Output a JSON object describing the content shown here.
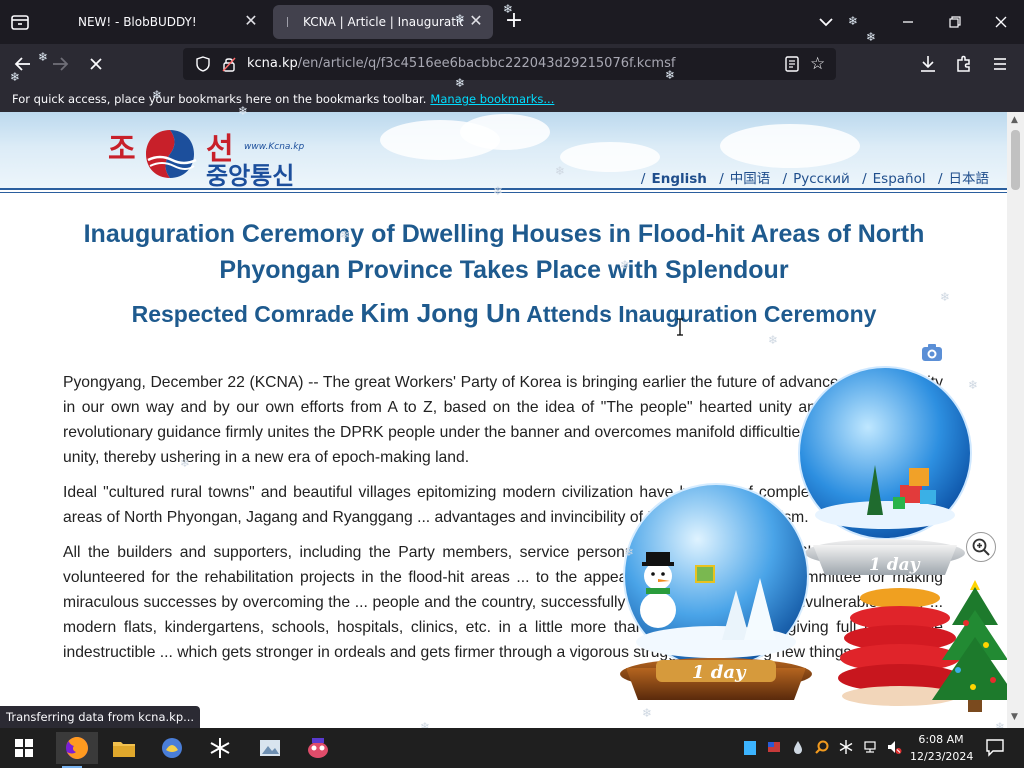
{
  "browser": {
    "tabs": [
      {
        "title": "NEW! - BlobBUDDY!",
        "active": false
      },
      {
        "title": "KCNA | Article | Inauguration",
        "active": true
      }
    ],
    "url_host": "kcna.kp",
    "url_path": "/en/article/q/f3c4516ee6bacbbc222043d29215076f.kcmsf",
    "bookmarks_message": "For quick access, place your bookmarks here on the bookmarks toolbar.",
    "bookmarks_link": "Manage bookmarks...",
    "status_text": "Transferring data from kcna.kp..."
  },
  "site": {
    "logo_line1_a": "조",
    "logo_line1_b": "선",
    "logo_line2": "중앙통신",
    "logo_www": "www.Kcna.kp",
    "languages": [
      "English",
      "中国语",
      "Русский",
      "Español",
      "日本語"
    ],
    "active_language": "English"
  },
  "article": {
    "title": "Inauguration Ceremony of Dwelling Houses in Flood-hit Areas of North Phyongan Province Takes Place with Splendour",
    "subtitle_pre": "Respected Comrade ",
    "subtitle_name": "Kim Jong Un",
    "subtitle_post": " Attends Inauguration Ceremony",
    "paragraphs": [
      "Pyongyang, December 22 (KCNA) -- The great Workers' Party of Korea is bringing earlier the future of advance and prosperity in our own way and by our own efforts from A to Z, based on the idea of \"The people\" hearted unity and self-reliance. Its revolutionary guidance firmly unites the DPRK people under the banner and overcomes manifold difficulties by dint of the great unity, thereby ushering in a new era of epoch-making land.",
      "Ideal \"cultured rural towns\" and beautiful villages epitomizing modern civilization have been ... of completion in the flood-hit areas of North Phyongan, Jagang and Ryanggang ... advantages and invincibility of Korean-style socialism.",
      "All the builders and supporters, including the Party members, service personnel ... Paektusan Hero Shock Brigade, who volunteered for the rehabilitation projects in the flood-hit areas ... to the appeal of the Party Central Committee for making miraculous successes by overcoming the ... people and the country, successfully built the embankments invulnerable to any ... modern flats, kindergartens, schools, hospitals, clinics, etc. in a little more than four months, thus giving full play to the indestructible ... which gets stronger in ordeals and gets firmer through a vigorous struggle for creating new things."
    ]
  },
  "overlay": {
    "globe_left_label": "1 day",
    "globe_right_label": "1 day"
  },
  "taskbar": {
    "time": "6:08 AM",
    "date": "12/23/2024"
  }
}
